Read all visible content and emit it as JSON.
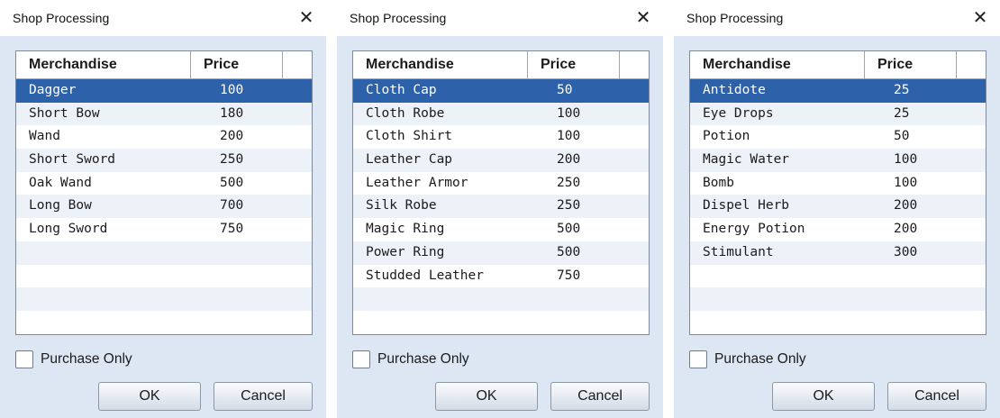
{
  "dialogs": [
    {
      "title": "Shop Processing",
      "close_glyph": "✕",
      "headers": {
        "merchandise": "Merchandise",
        "price": "Price"
      },
      "items": [
        {
          "name": "Dagger",
          "price": "100"
        },
        {
          "name": "Short Bow",
          "price": "180"
        },
        {
          "name": "Wand",
          "price": "200"
        },
        {
          "name": "Short Sword",
          "price": "250"
        },
        {
          "name": "Oak Wand",
          "price": "500"
        },
        {
          "name": "Long Bow",
          "price": "700"
        },
        {
          "name": "Long Sword",
          "price": "750"
        }
      ],
      "purchase_only": "Purchase Only",
      "ok_label": "OK",
      "cancel_label": "Cancel"
    },
    {
      "title": "Shop Processing",
      "close_glyph": "✕",
      "headers": {
        "merchandise": "Merchandise",
        "price": "Price"
      },
      "items": [
        {
          "name": "Cloth Cap",
          "price": "50"
        },
        {
          "name": "Cloth Robe",
          "price": "100"
        },
        {
          "name": "Cloth Shirt",
          "price": "100"
        },
        {
          "name": "Leather Cap",
          "price": "200"
        },
        {
          "name": "Leather Armor",
          "price": "250"
        },
        {
          "name": "Silk Robe",
          "price": "250"
        },
        {
          "name": "Magic Ring",
          "price": "500"
        },
        {
          "name": "Power Ring",
          "price": "500"
        },
        {
          "name": "Studded Leather",
          "price": "750"
        }
      ],
      "purchase_only": "Purchase Only",
      "ok_label": "OK",
      "cancel_label": "Cancel"
    },
    {
      "title": "Shop Processing",
      "close_glyph": "✕",
      "headers": {
        "merchandise": "Merchandise",
        "price": "Price"
      },
      "items": [
        {
          "name": "Antidote",
          "price": "25"
        },
        {
          "name": "Eye Drops",
          "price": "25"
        },
        {
          "name": "Potion",
          "price": "50"
        },
        {
          "name": "Magic Water",
          "price": "100"
        },
        {
          "name": "Bomb",
          "price": "100"
        },
        {
          "name": "Dispel Herb",
          "price": "200"
        },
        {
          "name": "Energy Potion",
          "price": "200"
        },
        {
          "name": "Stimulant",
          "price": "300"
        }
      ],
      "purchase_only": "Purchase Only",
      "ok_label": "OK",
      "cancel_label": "Cancel"
    }
  ],
  "selected_row_index": 0,
  "colors": {
    "dialog_bg": "#dde7f4",
    "selection": "#2d61aa",
    "alt_row": "#edf2f9"
  }
}
